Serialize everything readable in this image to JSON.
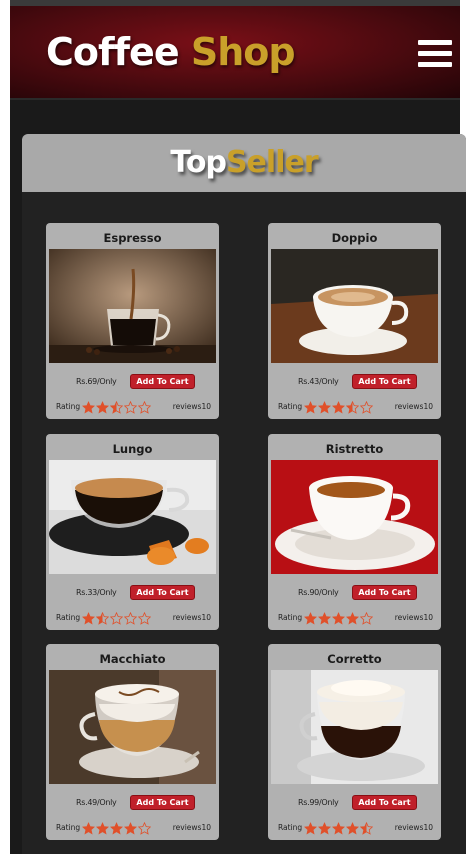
{
  "header": {
    "logo_word1": "Coffee",
    "logo_word2": "Shop",
    "menu_icon": "hamburger-menu-icon"
  },
  "section": {
    "title_word1": "Top",
    "title_word2": "Seller"
  },
  "colors": {
    "brand_red": "#c0202a",
    "brand_gold": "#c9a02a",
    "header_bg": "#5a0b12",
    "card_bg": "#b1b1b1",
    "star": "#e0502a"
  },
  "products": [
    {
      "name": "Espresso",
      "price": "Rs.69/Only",
      "cart_label": "Add To Cart",
      "rating_label": "Rating",
      "rating": 2.5,
      "reviews": "reviews10"
    },
    {
      "name": "Doppio",
      "price": "Rs.43/Only",
      "cart_label": "Add To Cart",
      "rating_label": "Rating",
      "rating": 3.5,
      "reviews": "reviews10"
    },
    {
      "name": "Lungo",
      "price": "Rs.33/Only",
      "cart_label": "Add To Cart",
      "rating_label": "Rating",
      "rating": 1.5,
      "reviews": "reviews10"
    },
    {
      "name": "Ristretto",
      "price": "Rs.90/Only",
      "cart_label": "Add To Cart",
      "rating_label": "Rating",
      "rating": 4,
      "reviews": "reviews10"
    },
    {
      "name": "Macchiato",
      "price": "Rs.49/Only",
      "cart_label": "Add To Cart",
      "rating_label": "Rating",
      "rating": 4,
      "reviews": "reviews10"
    },
    {
      "name": "Corretto",
      "price": "Rs.99/Only",
      "cart_label": "Add To Cart",
      "rating_label": "Rating",
      "rating": 4.5,
      "reviews": "reviews10"
    }
  ]
}
